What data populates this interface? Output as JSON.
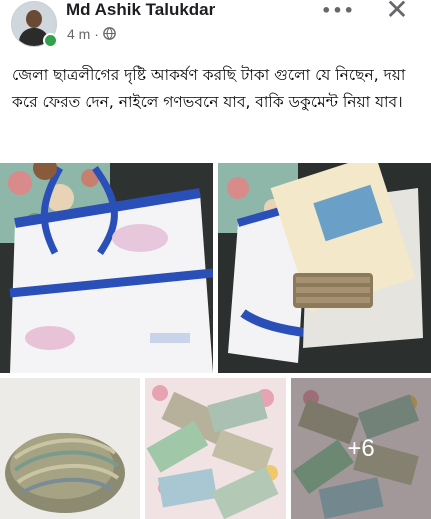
{
  "post": {
    "author": "Md Ashik Talukdar",
    "time": "4 m",
    "separator": "·",
    "privacy_icon": "globe-icon",
    "more_icon": "ellipsis-icon",
    "close_icon": "close-icon",
    "more_label": "•••",
    "close_label": "✕",
    "text": "জেলা ছাত্রলীগের দৃষ্টি আকর্ষণ করছি  টাকা গুলো যে নিছেন, দয়া করে ফেরত দেন, নাইলে গণভবনে যাব, বাকি ডকুমেন্ট নিয়া যাব।"
  },
  "photos": {
    "count": 5,
    "more_count": "+6"
  },
  "colors": {
    "online": "#31a24c",
    "meta": "#65676b",
    "bag_blue": "#2b4fb8"
  }
}
